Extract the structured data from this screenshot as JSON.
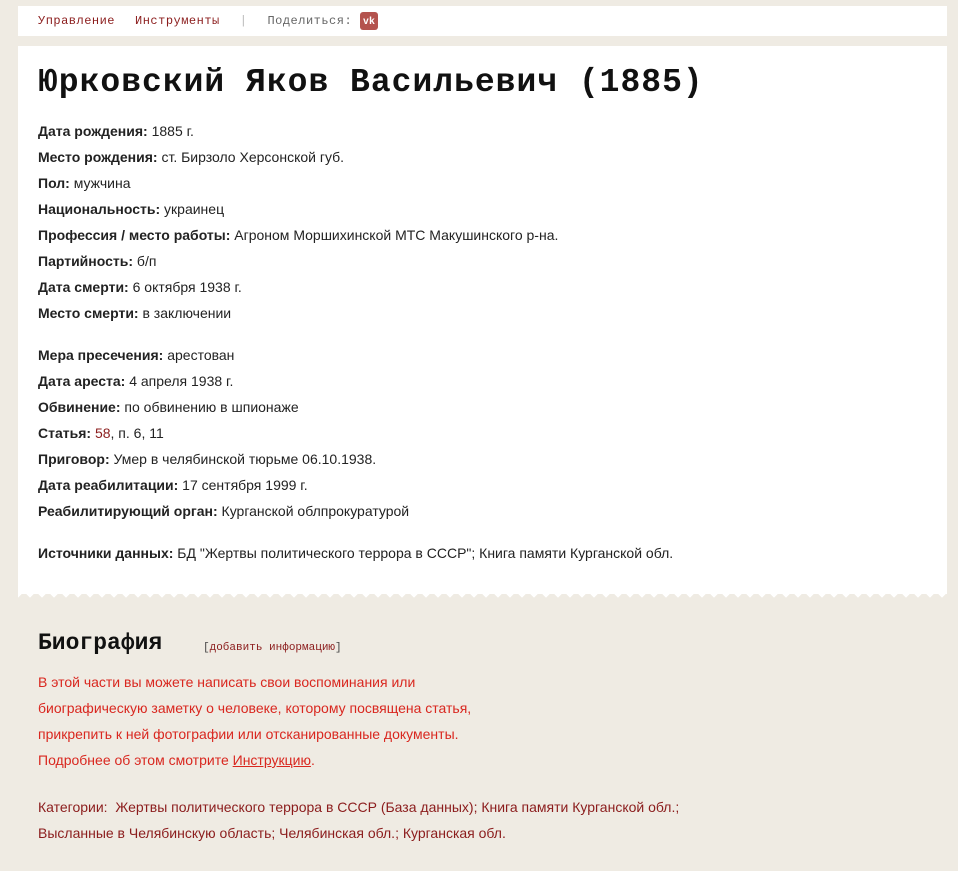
{
  "topbar": {
    "manage": "Управление",
    "tools": "Инструменты",
    "separator": "|",
    "share_label": "Поделиться:",
    "vk_label": "vk"
  },
  "person": {
    "title": "Юрковский Яков Васильевич (1885)",
    "fields_1": [
      {
        "label": "Дата рождения:",
        "value": " 1885 г."
      },
      {
        "label": "Место рождения:",
        "value": " ст. Бирзоло Херсонской губ."
      },
      {
        "label": "Пол:",
        "value": " мужчина"
      },
      {
        "label": "Национальность:",
        "value": " украинец"
      },
      {
        "label": "Профессия / место работы:",
        "value": " Агроном Моршихинской МТС Макушинского р-на."
      },
      {
        "label": "Партийность:",
        "value": " б/п"
      },
      {
        "label": "Дата смерти:",
        "value": " 6 октября 1938 г."
      },
      {
        "label": "Место смерти:",
        "value": " в заключении"
      }
    ],
    "fields_2": [
      {
        "label": "Мера пресечения:",
        "value": " арестован"
      },
      {
        "label": "Дата ареста:",
        "value": " 4 апреля 1938 г."
      },
      {
        "label": "Обвинение:",
        "value": " по обвинению в шпионаже"
      }
    ],
    "article": {
      "label": "Статья:",
      "link": "58",
      "rest": ", п. 6, 11"
    },
    "fields_3": [
      {
        "label": "Приговор:",
        "value": " Умер в челябинской тюрьме 06.10.1938."
      },
      {
        "label": "Дата реабилитации:",
        "value": " 17 сентября 1999 г."
      },
      {
        "label": "Реабилитирующий орган:",
        "value": " Курганской облпрокуратурой"
      }
    ],
    "sources": {
      "label": "Источники данных:",
      "value": " БД \"Жертвы политического террора в СССР\"; Книга памяти Курганской обл."
    }
  },
  "biography": {
    "heading": "Биография",
    "add_open": "[",
    "add_link": "добавить информацию",
    "add_close": "]",
    "lines": [
      "В этой части вы можете написать свои воспоминания или",
      "биографическую заметку о человеке, которому посвящена статья,",
      "прикрепить к ней фотографии или отсканированные документы."
    ],
    "more_prefix": "Подробнее об этом смотрите ",
    "more_link": "Инструкцию",
    "more_suffix": "."
  },
  "categories": {
    "label": "Категории:",
    "items_line1": [
      "Жертвы политического террора в СССР (База данных)",
      "Книга памяти Курганской обл."
    ],
    "items_line2": [
      "Высланные в Челябинскую область",
      "Челябинская обл.",
      "Курганская обл."
    ]
  },
  "colors": {
    "accent": "#8b1c1c",
    "bio_text": "#d9271f",
    "background": "#efebe3",
    "vk": "#b4534e"
  }
}
